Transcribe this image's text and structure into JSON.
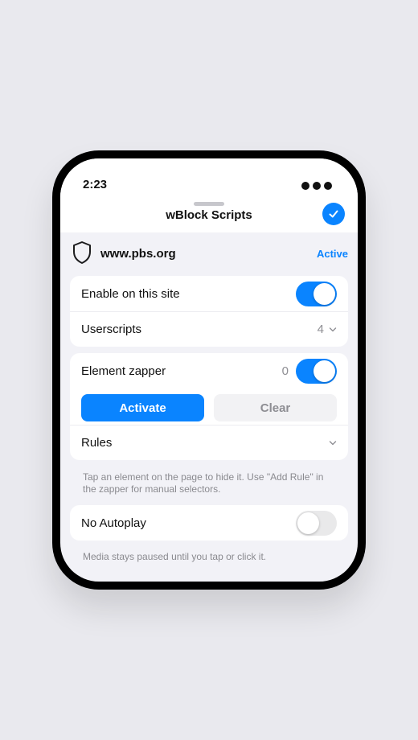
{
  "status_bar": {
    "time": "2:23"
  },
  "header": {
    "title": "wBlock Scripts"
  },
  "site": {
    "domain": "www.pbs.org",
    "status": "Active"
  },
  "main_card": {
    "enable_label": "Enable on this site",
    "enable_on": true,
    "userscripts_label": "Userscripts",
    "userscripts_count": "4"
  },
  "zapper_card": {
    "label": "Element zapper",
    "count": "0",
    "enabled": true,
    "activate_label": "Activate",
    "clear_label": "Clear",
    "rules_label": "Rules",
    "footnote": "Tap an element on the page to hide it. Use \"Add Rule\" in the zapper for manual selectors."
  },
  "autoplay_card": {
    "label": "No Autoplay",
    "enabled": false,
    "footnote": "Media stays paused until you tap or click it."
  },
  "colors": {
    "accent": "#0a84ff",
    "background": "#f2f2f7"
  }
}
